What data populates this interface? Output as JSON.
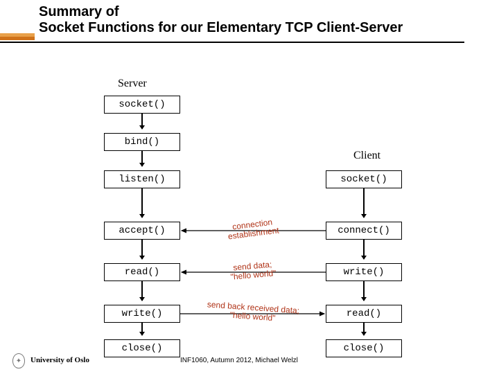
{
  "title": "Summary of\nSocket Functions for our Elementary TCP Client-Server",
  "columns": {
    "server": "Server",
    "client": "Client"
  },
  "server_boxes": {
    "socket": "socket()",
    "bind": "bind()",
    "listen": "listen()",
    "accept": "accept()",
    "read": "read()",
    "write": "write()",
    "close": "close()"
  },
  "client_boxes": {
    "socket": "socket()",
    "connect": "connect()",
    "write": "write()",
    "read": "read()",
    "close": "close()"
  },
  "annotations": {
    "conn_est_1": "connection",
    "conn_est_2": "establishment",
    "send_data_1": "send data;",
    "send_data_2": "\"hello world\"",
    "send_back_1": "send back received data;",
    "send_back_2": "\"hello world\""
  },
  "footer": {
    "university": "University of Oslo",
    "course": "INF1060, Autumn 2012, Michael Welzl"
  },
  "chart_data": {
    "type": "diagram",
    "title": "Summary of Socket Functions for our Elementary TCP Client-Server",
    "nodes": [
      {
        "id": "s_socket",
        "column": "server",
        "label": "socket()"
      },
      {
        "id": "s_bind",
        "column": "server",
        "label": "bind()"
      },
      {
        "id": "s_listen",
        "column": "server",
        "label": "listen()"
      },
      {
        "id": "s_accept",
        "column": "server",
        "label": "accept()"
      },
      {
        "id": "s_read",
        "column": "server",
        "label": "read()"
      },
      {
        "id": "s_write",
        "column": "server",
        "label": "write()"
      },
      {
        "id": "s_close",
        "column": "server",
        "label": "close()"
      },
      {
        "id": "c_socket",
        "column": "client",
        "label": "socket()"
      },
      {
        "id": "c_connect",
        "column": "client",
        "label": "connect()"
      },
      {
        "id": "c_write",
        "column": "client",
        "label": "write()"
      },
      {
        "id": "c_read",
        "column": "client",
        "label": "read()"
      },
      {
        "id": "c_close",
        "column": "client",
        "label": "close()"
      }
    ],
    "edges": [
      {
        "from": "s_socket",
        "to": "s_bind",
        "type": "sequence"
      },
      {
        "from": "s_bind",
        "to": "s_listen",
        "type": "sequence"
      },
      {
        "from": "s_listen",
        "to": "s_accept",
        "type": "sequence"
      },
      {
        "from": "s_accept",
        "to": "s_read",
        "type": "sequence"
      },
      {
        "from": "s_read",
        "to": "s_write",
        "type": "sequence"
      },
      {
        "from": "s_write",
        "to": "s_close",
        "type": "sequence"
      },
      {
        "from": "c_socket",
        "to": "c_connect",
        "type": "sequence"
      },
      {
        "from": "c_connect",
        "to": "c_write",
        "type": "sequence"
      },
      {
        "from": "c_write",
        "to": "c_read",
        "type": "sequence"
      },
      {
        "from": "c_read",
        "to": "c_close",
        "type": "sequence"
      },
      {
        "from": "c_connect",
        "to": "s_accept",
        "type": "message",
        "label": "connection establishment"
      },
      {
        "from": "c_write",
        "to": "s_read",
        "type": "message",
        "label": "send data; \"hello world\""
      },
      {
        "from": "s_write",
        "to": "c_read",
        "type": "message",
        "label": "send back received data; \"hello world\""
      }
    ]
  }
}
